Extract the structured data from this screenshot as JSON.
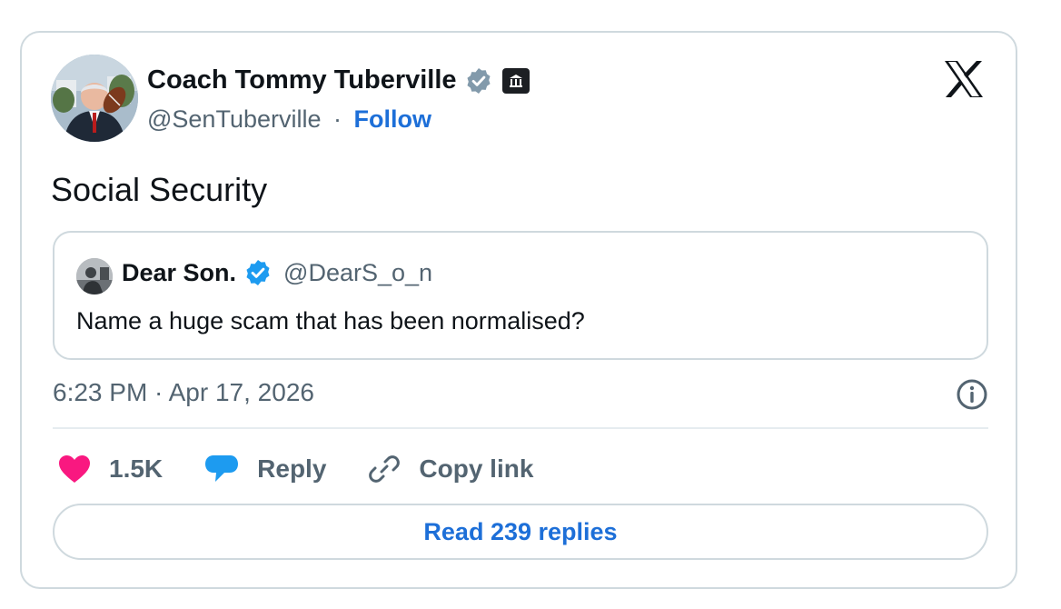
{
  "author": {
    "name": "Coach Tommy Tuberville",
    "handle": "@SenTuberville",
    "separator": "·",
    "follow_label": "Follow"
  },
  "tweet": {
    "text": "Social Security",
    "timestamp": "6:23 PM · Apr 17, 2026"
  },
  "quote": {
    "name": "Dear Son.",
    "handle": "@DearS_o_n",
    "text": "Name a huge scam that has been normalised?"
  },
  "actions": {
    "like_count": "1.5K",
    "reply_label": "Reply",
    "copy_link_label": "Copy link"
  },
  "read_replies_label": "Read 239 replies",
  "icons": {
    "brand": "x-logo-icon",
    "info": "info-icon",
    "like": "heart-icon",
    "reply": "speech-bubble-icon",
    "copy": "link-icon"
  },
  "colors": {
    "link_blue": "#1d6fd8",
    "like_pink": "#f91880",
    "reply_blue": "#1d9bf0",
    "muted_text": "#536471",
    "border": "#cfd9de"
  }
}
